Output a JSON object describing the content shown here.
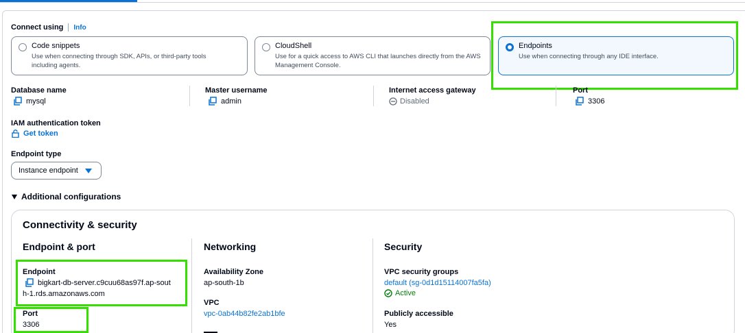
{
  "connect": {
    "heading": "Connect using",
    "info_link": "Info",
    "options": [
      {
        "title": "Code snippets",
        "desc": "Use when connecting through SDK, APIs, or third-party tools including agents.",
        "selected": false
      },
      {
        "title": "CloudShell",
        "desc": "Use for a quick access to AWS CLI that launches directly from the AWS Management Console.",
        "selected": false
      },
      {
        "title": "Endpoints",
        "desc": "Use when connecting through any IDE interface.",
        "selected": true
      }
    ]
  },
  "summary": {
    "database_name": {
      "label": "Database name",
      "value": "mysql"
    },
    "master_username": {
      "label": "Master username",
      "value": "admin"
    },
    "internet_gateway": {
      "label": "Internet access gateway",
      "value": "Disabled"
    },
    "port": {
      "label": "Port",
      "value": "3306"
    }
  },
  "iam": {
    "label": "IAM authentication token",
    "action": "Get token"
  },
  "endpoint_type": {
    "label": "Endpoint type",
    "selected": "Instance endpoint"
  },
  "additional": {
    "label": "Additional configurations"
  },
  "connectivity": {
    "title": "Connectivity & security",
    "endpoint_port": {
      "heading": "Endpoint & port",
      "endpoint_label": "Endpoint",
      "endpoint_line1": "bigkart-db-server.c9cuu68as97f.ap-sout",
      "endpoint_line2": "h-1.rds.amazonaws.com",
      "port_label": "Port",
      "port_value": "3306"
    },
    "networking": {
      "heading": "Networking",
      "az_label": "Availability Zone",
      "az_value": "ap-south-1b",
      "vpc_label": "VPC",
      "vpc_value": "vpc-0ab44b82fe2ab1bfe"
    },
    "security": {
      "heading": "Security",
      "sg_label": "VPC security groups",
      "sg_value": "default (sg-0d1d15114007fa5fa)",
      "sg_status": "Active",
      "public_label": "Publicly accessible",
      "public_value": "Yes"
    }
  },
  "colors": {
    "accent": "#0972d3",
    "highlight": "#33e000",
    "success": "#037f0c"
  }
}
